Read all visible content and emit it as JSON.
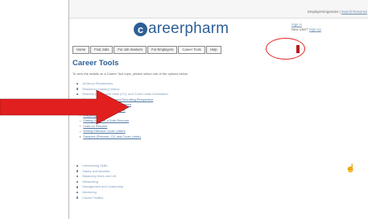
{
  "top_bar": {
    "employers_label": "Employers/Agencies",
    "search_label": "Search Resumes"
  },
  "logo": {
    "mark": "c",
    "word": "areerpharm"
  },
  "auth": {
    "signin": "Sign in",
    "new_user": "New User?",
    "signup": "Sign Up"
  },
  "nav": {
    "items": [
      {
        "label": "Home"
      },
      {
        "label": "Find Jobs"
      },
      {
        "label": "For Job Seekers"
      },
      {
        "label": "For Employers"
      },
      {
        "label": "Career Tools"
      },
      {
        "label": "Help"
      }
    ],
    "active": "Career Tools"
  },
  "page": {
    "title": "Career Tools",
    "intro": "To view the details on a Career Tool topic, please select one of the options below."
  },
  "tools_list": [
    {
      "label": "All About Residencies",
      "level": 1
    },
    {
      "label": "Residency Training Videos",
      "level": 1
    },
    {
      "label": "Resume (Curriculum Vitae (CV), and Cover Letter Information",
      "level": 1
    },
    {
      "label": "Resume Tips - A Pharmacy Recruiting Perspective",
      "level": 2
    },
    {
      "label": "Conquering the Online Job Search",
      "level": 2
    },
    {
      "label": "When to Use a CV or Resume",
      "level": 2
    },
    {
      "label": "Preparing a CV",
      "level": 2
    },
    {
      "label": "Putting Together a Solid Resume",
      "level": 2
    },
    {
      "label": "Links on Resume",
      "level": 2
    },
    {
      "label": "Writing Effective Cover Letters",
      "level": 2
    },
    {
      "label": "Samples (Resume, CV, and Cover Letter)",
      "level": 2
    },
    {
      "label": "Interviewing Skills",
      "level": 1
    },
    {
      "label": "Salary and Benefits",
      "level": 1
    },
    {
      "label": "Balancing Work and Life",
      "level": 1
    },
    {
      "label": "Networking",
      "level": 1
    },
    {
      "label": "Management and Leadership",
      "level": 1
    },
    {
      "label": "Mentoring",
      "level": 1
    },
    {
      "label": "Career Profiles",
      "level": 1
    }
  ],
  "annotations": {
    "arrow_color": "#e21f1f",
    "circle_color": "#e42626",
    "cursor_icon": "hand-cursor-icon"
  }
}
